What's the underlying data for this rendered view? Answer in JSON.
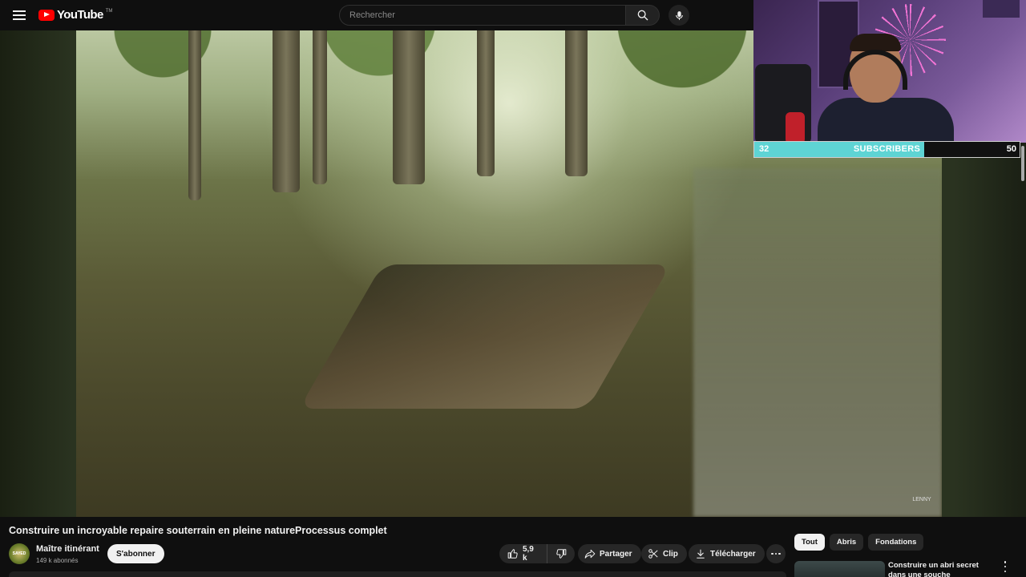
{
  "header": {
    "logo_text": "YouTube",
    "logo_tm": "TM",
    "search_placeholder": "Rechercher"
  },
  "webcam_overlay": {
    "subscriber_goal": {
      "current": "32",
      "label": "SUBSCRIBERS",
      "goal": "50",
      "progress_fraction": 0.64,
      "fill_color": "#5ed4d4"
    }
  },
  "video": {
    "watermark": "LENNY"
  },
  "video_info": {
    "title": "Construire un incroyable repaire souterrain en pleine natureProcessus complet",
    "channel_name": "Maître itinérant",
    "channel_subscribers": "149 k abonnés",
    "avatar_text": "SAYED",
    "subscribe_label": "S'abonner",
    "like_count": "5,9 k",
    "share_label": "Partager",
    "clip_label": "Clip",
    "download_label": "Télécharger"
  },
  "sidebar": {
    "chips": [
      {
        "label": "Tout",
        "active": true
      },
      {
        "label": "Abris",
        "active": false
      },
      {
        "label": "Fondations",
        "active": false
      }
    ],
    "recommendation": {
      "title": "Construire un abri secret dans une souche d'arbreSurvie"
    }
  },
  "colors": {
    "background": "#0f0f0f",
    "brand_red": "#ff0000",
    "pill": "#272727"
  }
}
